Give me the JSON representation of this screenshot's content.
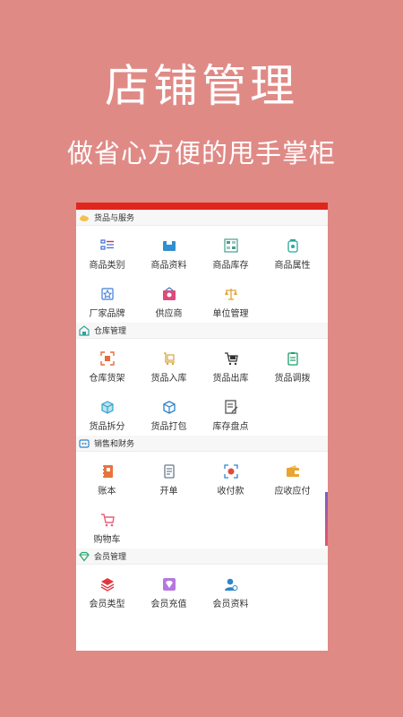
{
  "hero": {
    "title": "店铺管理",
    "subtitle": "做省心方便的甩手掌柜"
  },
  "sections": [
    {
      "title": "货品与服务",
      "items": [
        {
          "label": "商品类别",
          "icon": "category-list-icon",
          "color": "#3D6BD6"
        },
        {
          "label": "商品资料",
          "icon": "product-box-icon",
          "color": "#2F8FD0"
        },
        {
          "label": "商品库存",
          "icon": "inventory-shelf-icon",
          "color": "#4A9E8C"
        },
        {
          "label": "商品属性",
          "icon": "attribute-jar-icon",
          "color": "#27A8A0"
        },
        {
          "label": "厂家品牌",
          "icon": "brand-badge-icon",
          "color": "#3D7FD6"
        },
        {
          "label": "供应商",
          "icon": "supplier-card-icon",
          "color": "#E04A7A"
        },
        {
          "label": "单位管理",
          "icon": "scale-icon",
          "color": "#E3A53A"
        }
      ]
    },
    {
      "title": "仓库管理",
      "items": [
        {
          "label": "仓库货架",
          "icon": "scan-shelf-icon",
          "color": "#E96B3C"
        },
        {
          "label": "货品入库",
          "icon": "stock-in-cart-icon",
          "color": "#D9A441"
        },
        {
          "label": "货品出库",
          "icon": "stock-out-cart-icon",
          "color": "#333333"
        },
        {
          "label": "货品调拨",
          "icon": "transfer-clipboard-icon",
          "color": "#1E9E6E"
        },
        {
          "label": "货品拆分",
          "icon": "split-box-icon",
          "color": "#2FA3C9"
        },
        {
          "label": "货品打包",
          "icon": "pack-box-icon",
          "color": "#2A7FC9"
        },
        {
          "label": "库存盘点",
          "icon": "stocktake-doc-icon",
          "color": "#555555"
        }
      ]
    },
    {
      "title": "销售和财务",
      "items": [
        {
          "label": "账本",
          "icon": "ledger-book-icon",
          "color": "#E8743B"
        },
        {
          "label": "开单",
          "icon": "invoice-doc-icon",
          "color": "#6B7A8F"
        },
        {
          "label": "收付款",
          "icon": "payment-scan-icon",
          "color": "#E14B3B"
        },
        {
          "label": "应收应付",
          "icon": "wallet-icon",
          "color": "#E8A531"
        },
        {
          "label": "购物车",
          "icon": "shopping-cart-icon",
          "color": "#E8617A"
        }
      ]
    },
    {
      "title": "会员管理",
      "items": [
        {
          "label": "会员类型",
          "icon": "member-layers-icon",
          "color": "#E0383E"
        },
        {
          "label": "会员充值",
          "icon": "recharge-diamond-icon",
          "color": "#B678E0"
        },
        {
          "label": "会员资料",
          "icon": "member-profile-icon",
          "color": "#2E86C9"
        }
      ]
    }
  ],
  "colors": {
    "background": "#E08A86",
    "topbar": "#E0261C"
  }
}
